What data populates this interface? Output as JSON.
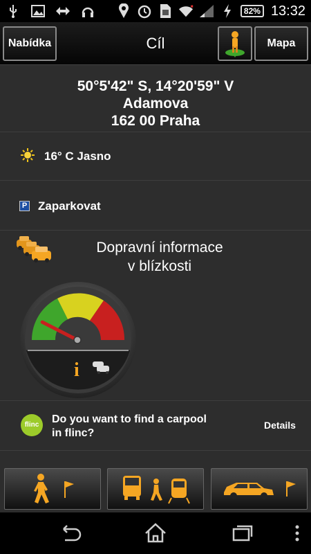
{
  "status_bar": {
    "left_icons": [
      "usb-icon",
      "image-icon",
      "sync-icon",
      "headphones-icon"
    ],
    "right_icons": [
      "location-icon",
      "alarm-icon",
      "sim-icon",
      "wifi-icon",
      "signal-icon",
      "charging-icon"
    ],
    "battery": "82%",
    "time": "13:32"
  },
  "action_bar": {
    "menu_label": "Nabídka",
    "title": "Cíl",
    "map_label": "Mapa",
    "poi_icon": "person-pin-icon"
  },
  "destination": {
    "coordinates": "50°5'42\" S, 14°20'59\" V",
    "street": "Adamova",
    "city": "162 00 Praha"
  },
  "weather": {
    "icon": "sun-icon",
    "text": "16° C Jasno"
  },
  "parking": {
    "icon": "parking-icon",
    "badge": "P",
    "label": "Zaparkovat"
  },
  "traffic": {
    "title_line1": "Dopravní informace",
    "title_line2": "v blízkosti",
    "gauge_level": 0.15,
    "colors": {
      "green": "#3fa62c",
      "yellow": "#d8d21f",
      "red": "#c8201f"
    }
  },
  "flinc": {
    "logo": "flinc",
    "text_line1": "Do you want to find a carpool",
    "text_line2": "in flinc?",
    "details_label": "Details"
  },
  "transport_modes": [
    {
      "name": "walk",
      "icons": [
        "walker-icon",
        "flag-icon"
      ]
    },
    {
      "name": "public-transport",
      "icons": [
        "bus-icon",
        "walker-icon",
        "train-icon"
      ]
    },
    {
      "name": "car",
      "icons": [
        "car-icon",
        "flag-icon"
      ]
    }
  ],
  "accent": "#f5a623"
}
